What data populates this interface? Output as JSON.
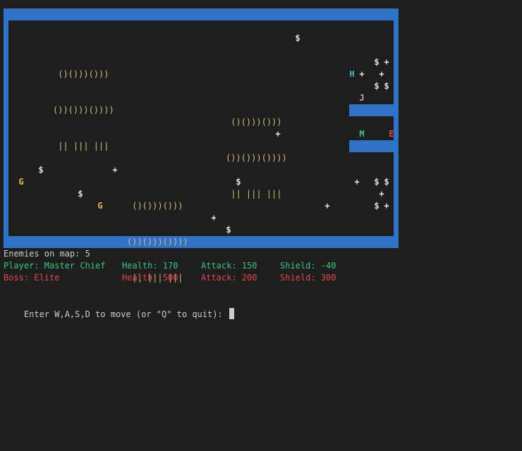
{
  "map": {
    "colors": {
      "wall": "#2f72c6",
      "floor": "#1e1e1e",
      "coin": "#e5e5e5",
      "plus": "#e5e5e5",
      "goblin": "#e5b84b",
      "tree": "#d7ba7d",
      "hero_h": "#3fb6c9",
      "hero_j": "#d0a0d8",
      "player": "#3cc67a",
      "boss": "#e0474c"
    },
    "glyph_coin": "$",
    "glyph_plus": "+",
    "glyph_goblin": "G",
    "glyph_h": "H",
    "glyph_j": "J",
    "glyph_player": "M",
    "glyph_boss": "E",
    "tree_art": {
      "line1": " ()()))()))",
      "line2": "())()))()))) ",
      "line3": " || ||| |||"
    }
  },
  "status": {
    "enemies_label": "Enemies on map: 5",
    "player": {
      "name": "Player: Master Chief",
      "health": "Health: 170",
      "attack": "Attack: 150",
      "shield": "Shield: -40"
    },
    "boss": {
      "name": "Boss: Elite",
      "health": "Health: 500",
      "attack": "Attack: 200",
      "shield": "Shield: 300"
    },
    "prompt": "Enter W,A,S,D to move (or \"Q\" to quit): "
  }
}
